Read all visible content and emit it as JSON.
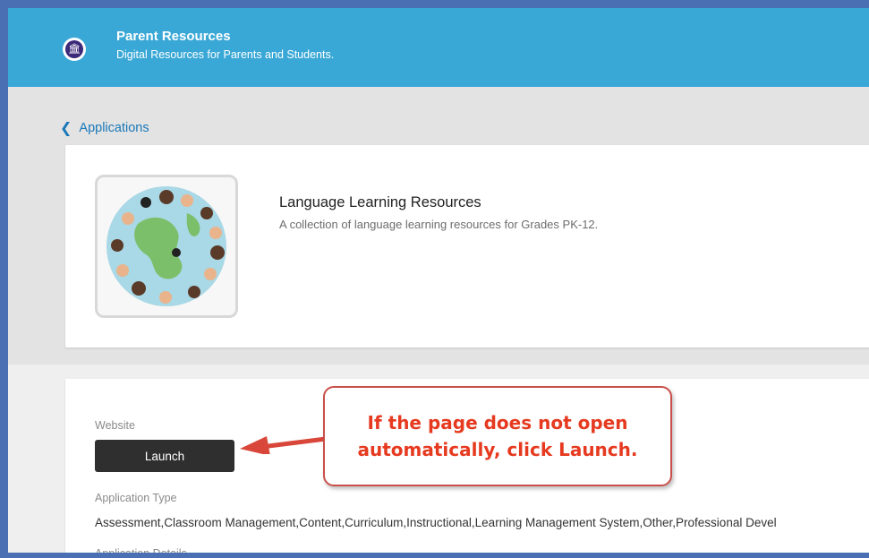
{
  "header": {
    "title": "Parent Resources",
    "subtitle": "Digital Resources for Parents and Students."
  },
  "nav": {
    "back_label": "Applications"
  },
  "app": {
    "title": "Language Learning Resources",
    "description": "A collection of language learning resources for Grades PK-12."
  },
  "details": {
    "website_label": "Website",
    "launch_label": "Launch",
    "app_type_label": "Application Type",
    "app_type_value": "Assessment,Classroom Management,Content,Curriculum,Instructional,Learning Management System,Other,Professional Devel",
    "app_details_label": "Application Details"
  },
  "callout": {
    "line1": "If the page does not open",
    "line2": "automatically, click Launch."
  },
  "colors": {
    "header_bg": "#3aa8d6",
    "link": "#1a78b8",
    "callout_text": "#e63a20",
    "frame_border": "#4a6fb3"
  },
  "icons": {
    "back": "chevron-left-icon",
    "logo": "school-logo-icon",
    "thumbnail": "globe-hands-icon"
  }
}
